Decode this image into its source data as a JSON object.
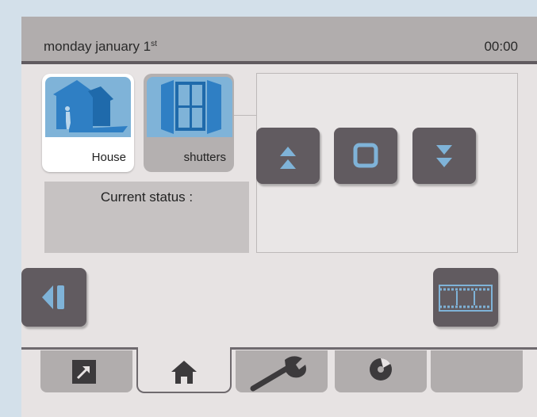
{
  "header": {
    "date_main": "monday january 1",
    "date_suffix": "st",
    "time": "00:00"
  },
  "tiles": [
    {
      "label": "House",
      "icon": "house-icon",
      "selected": true
    },
    {
      "label": "shutters",
      "icon": "shutters-icon",
      "selected": false
    }
  ],
  "status": {
    "label": "Current status :"
  },
  "controls": {
    "up_icon": "double-up-arrow-icon",
    "stop_icon": "stop-square-icon",
    "down_icon": "double-down-arrow-icon"
  },
  "navigation": {
    "back_icon": "back-icon",
    "film_icon": "film-strip-icon"
  },
  "tabs": [
    {
      "icon": "external-link-icon",
      "active": false
    },
    {
      "icon": "home-icon",
      "active": true
    },
    {
      "icon": "wrench-icon",
      "active": false
    },
    {
      "icon": "disc-icon",
      "active": false
    },
    {
      "icon": "",
      "active": false
    }
  ],
  "colors": {
    "accent_blue": "#7fb3d8",
    "icon_blue": "#2f7fc4",
    "button_dark": "#615b60",
    "header_bg": "#b1adad",
    "screen_bg": "#e7e3e3",
    "page_bg": "#d3e0ea"
  }
}
